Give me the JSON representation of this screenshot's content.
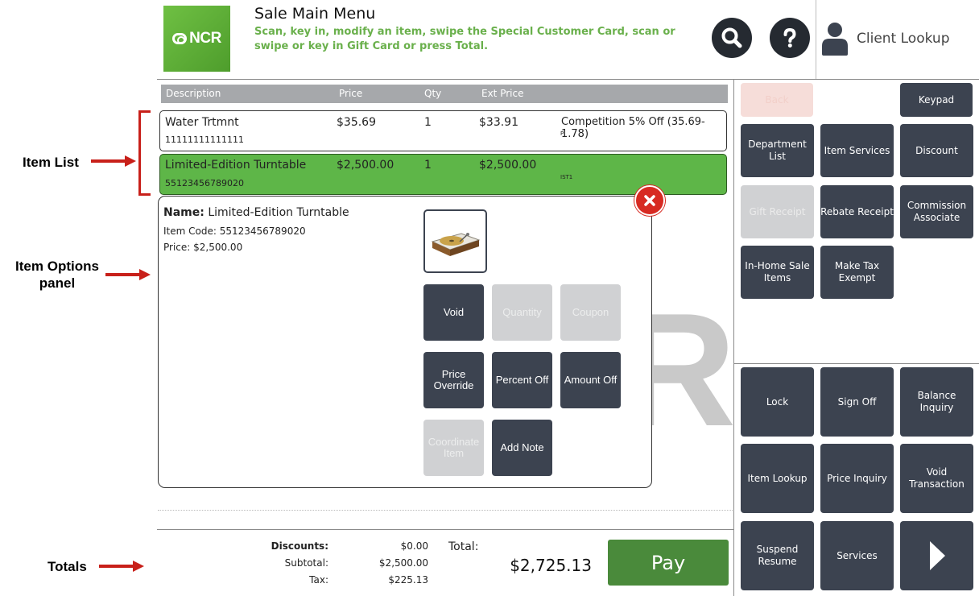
{
  "header": {
    "title": "Sale Main Menu",
    "instructions": "Scan, key in, modify an item, swipe the Special Customer Card, scan or swipe or key in Gift Card or press Total.",
    "logo_text": "NCR",
    "search_icon": "search-icon",
    "help_icon": "help-icon",
    "client_lookup_label": "Client Lookup",
    "accent_green": "#6ab04c"
  },
  "annotations": {
    "item_list": "Item List",
    "item_options_line1": "Item Options",
    "item_options_line2": "panel",
    "totals": "Totals"
  },
  "table": {
    "headers": {
      "description": "Description",
      "price": "Price",
      "qty": "Qty",
      "ext_price": "Ext Price"
    },
    "rows": [
      {
        "description": "Water Trtmnt",
        "code": "11111111111111",
        "price": "$35.69",
        "qty": "1",
        "ext_price": "$33.91",
        "note": "Competition 5% Off (35.69-1.78)",
        "flag": "P"
      },
      {
        "description": "Limited-Edition Turntable",
        "code": "55123456789020",
        "price": "$2,500.00",
        "qty": "1",
        "ext_price": "$2,500.00",
        "note": "",
        "flag": "IST1"
      }
    ]
  },
  "options": {
    "name_label": "Name:",
    "name_value": "Limited-Edition Turntable",
    "item_code": "Item Code: 55123456789020",
    "price": "Price: $2,500.00",
    "buttons": {
      "void": "Void",
      "quantity": "Quantity",
      "coupon": "Coupon",
      "price_override": "Price Override",
      "percent_off": "Percent Off",
      "amount_off": "Amount Off",
      "coordinate_item": "Coordinate Item",
      "add_note": "Add Note"
    }
  },
  "watermark": "R",
  "totals": {
    "discounts_label": "Discounts:",
    "discounts_value": "$0.00",
    "subtotal_label": "Subtotal:",
    "subtotal_value": "$2,500.00",
    "tax_label": "Tax:",
    "tax_value": "$225.13",
    "total_label": "Total:",
    "total_value": "$2,725.13",
    "pay_label": "Pay"
  },
  "right_panel": {
    "top": {
      "hidden_label": "Back",
      "keypad": "Keypad",
      "department_list": "Department List",
      "item_services": "Item Services",
      "discount": "Discount",
      "gift_receipt": "Gift Receipt",
      "rebate_receipt": "Rebate Receipt",
      "commission_associate": "Commission Associate",
      "in_home_sale_items": "In-Home Sale Items",
      "make_tax_exempt": "Make Tax Exempt"
    },
    "bottom": {
      "lock": "Lock",
      "sign_off": "Sign Off",
      "balance_inquiry": "Balance Inquiry",
      "item_lookup": "Item Lookup",
      "price_inquiry": "Price Inquiry",
      "void_transaction": "Void Transaction",
      "suspend_resume": "Suspend Resume",
      "services": "Services",
      "next_icon": "chevron-right-icon"
    }
  }
}
